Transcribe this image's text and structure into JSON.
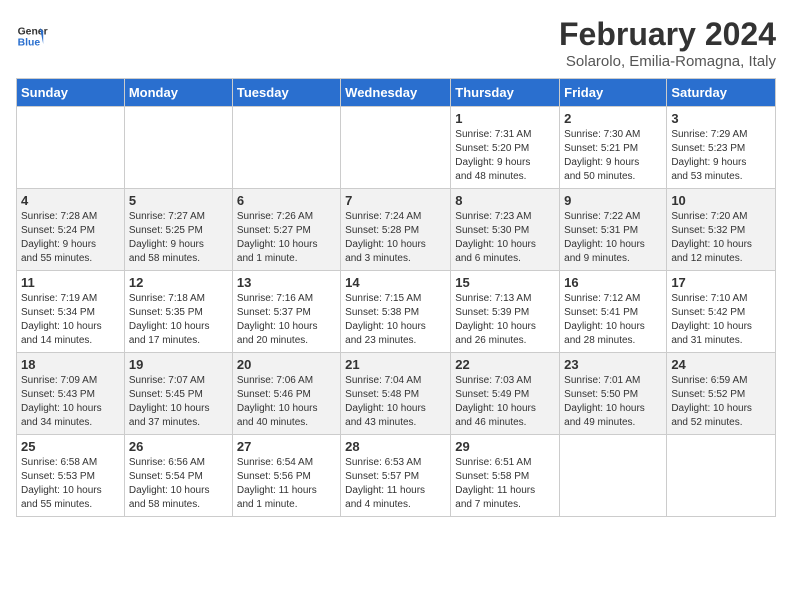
{
  "header": {
    "logo_line1": "General",
    "logo_line2": "Blue",
    "main_title": "February 2024",
    "sub_title": "Solarolo, Emilia-Romagna, Italy"
  },
  "days_of_week": [
    "Sunday",
    "Monday",
    "Tuesday",
    "Wednesday",
    "Thursday",
    "Friday",
    "Saturday"
  ],
  "weeks": [
    [
      {
        "day": "",
        "info": ""
      },
      {
        "day": "",
        "info": ""
      },
      {
        "day": "",
        "info": ""
      },
      {
        "day": "",
        "info": ""
      },
      {
        "day": "1",
        "info": "Sunrise: 7:31 AM\nSunset: 5:20 PM\nDaylight: 9 hours\nand 48 minutes."
      },
      {
        "day": "2",
        "info": "Sunrise: 7:30 AM\nSunset: 5:21 PM\nDaylight: 9 hours\nand 50 minutes."
      },
      {
        "day": "3",
        "info": "Sunrise: 7:29 AM\nSunset: 5:23 PM\nDaylight: 9 hours\nand 53 minutes."
      }
    ],
    [
      {
        "day": "4",
        "info": "Sunrise: 7:28 AM\nSunset: 5:24 PM\nDaylight: 9 hours\nand 55 minutes."
      },
      {
        "day": "5",
        "info": "Sunrise: 7:27 AM\nSunset: 5:25 PM\nDaylight: 9 hours\nand 58 minutes."
      },
      {
        "day": "6",
        "info": "Sunrise: 7:26 AM\nSunset: 5:27 PM\nDaylight: 10 hours\nand 1 minute."
      },
      {
        "day": "7",
        "info": "Sunrise: 7:24 AM\nSunset: 5:28 PM\nDaylight: 10 hours\nand 3 minutes."
      },
      {
        "day": "8",
        "info": "Sunrise: 7:23 AM\nSunset: 5:30 PM\nDaylight: 10 hours\nand 6 minutes."
      },
      {
        "day": "9",
        "info": "Sunrise: 7:22 AM\nSunset: 5:31 PM\nDaylight: 10 hours\nand 9 minutes."
      },
      {
        "day": "10",
        "info": "Sunrise: 7:20 AM\nSunset: 5:32 PM\nDaylight: 10 hours\nand 12 minutes."
      }
    ],
    [
      {
        "day": "11",
        "info": "Sunrise: 7:19 AM\nSunset: 5:34 PM\nDaylight: 10 hours\nand 14 minutes."
      },
      {
        "day": "12",
        "info": "Sunrise: 7:18 AM\nSunset: 5:35 PM\nDaylight: 10 hours\nand 17 minutes."
      },
      {
        "day": "13",
        "info": "Sunrise: 7:16 AM\nSunset: 5:37 PM\nDaylight: 10 hours\nand 20 minutes."
      },
      {
        "day": "14",
        "info": "Sunrise: 7:15 AM\nSunset: 5:38 PM\nDaylight: 10 hours\nand 23 minutes."
      },
      {
        "day": "15",
        "info": "Sunrise: 7:13 AM\nSunset: 5:39 PM\nDaylight: 10 hours\nand 26 minutes."
      },
      {
        "day": "16",
        "info": "Sunrise: 7:12 AM\nSunset: 5:41 PM\nDaylight: 10 hours\nand 28 minutes."
      },
      {
        "day": "17",
        "info": "Sunrise: 7:10 AM\nSunset: 5:42 PM\nDaylight: 10 hours\nand 31 minutes."
      }
    ],
    [
      {
        "day": "18",
        "info": "Sunrise: 7:09 AM\nSunset: 5:43 PM\nDaylight: 10 hours\nand 34 minutes."
      },
      {
        "day": "19",
        "info": "Sunrise: 7:07 AM\nSunset: 5:45 PM\nDaylight: 10 hours\nand 37 minutes."
      },
      {
        "day": "20",
        "info": "Sunrise: 7:06 AM\nSunset: 5:46 PM\nDaylight: 10 hours\nand 40 minutes."
      },
      {
        "day": "21",
        "info": "Sunrise: 7:04 AM\nSunset: 5:48 PM\nDaylight: 10 hours\nand 43 minutes."
      },
      {
        "day": "22",
        "info": "Sunrise: 7:03 AM\nSunset: 5:49 PM\nDaylight: 10 hours\nand 46 minutes."
      },
      {
        "day": "23",
        "info": "Sunrise: 7:01 AM\nSunset: 5:50 PM\nDaylight: 10 hours\nand 49 minutes."
      },
      {
        "day": "24",
        "info": "Sunrise: 6:59 AM\nSunset: 5:52 PM\nDaylight: 10 hours\nand 52 minutes."
      }
    ],
    [
      {
        "day": "25",
        "info": "Sunrise: 6:58 AM\nSunset: 5:53 PM\nDaylight: 10 hours\nand 55 minutes."
      },
      {
        "day": "26",
        "info": "Sunrise: 6:56 AM\nSunset: 5:54 PM\nDaylight: 10 hours\nand 58 minutes."
      },
      {
        "day": "27",
        "info": "Sunrise: 6:54 AM\nSunset: 5:56 PM\nDaylight: 11 hours\nand 1 minute."
      },
      {
        "day": "28",
        "info": "Sunrise: 6:53 AM\nSunset: 5:57 PM\nDaylight: 11 hours\nand 4 minutes."
      },
      {
        "day": "29",
        "info": "Sunrise: 6:51 AM\nSunset: 5:58 PM\nDaylight: 11 hours\nand 7 minutes."
      },
      {
        "day": "",
        "info": ""
      },
      {
        "day": "",
        "info": ""
      }
    ]
  ]
}
